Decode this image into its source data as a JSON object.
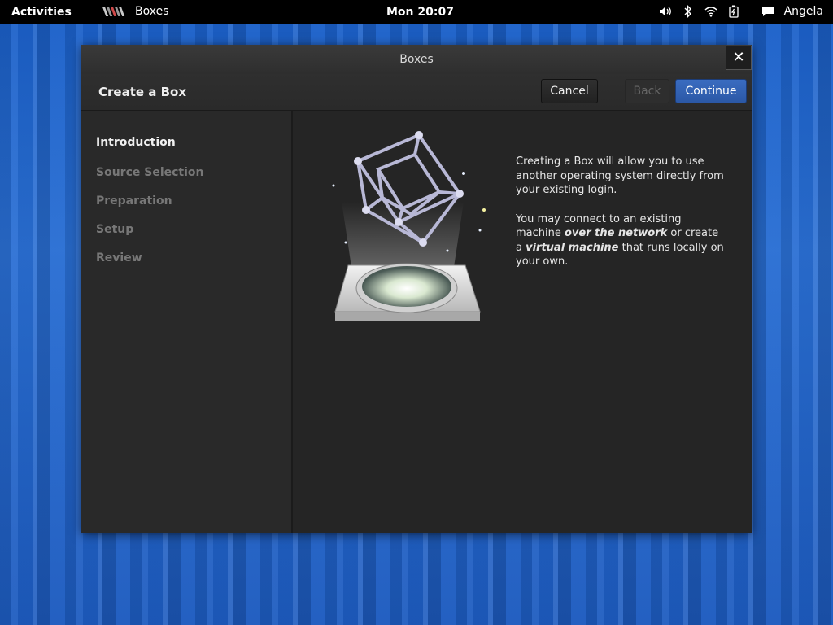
{
  "topbar": {
    "activities": "Activities",
    "app_name": "Boxes",
    "clock": "Mon 20:07",
    "user": "Angela",
    "tray_icons": [
      "volume-icon",
      "bluetooth-icon",
      "wifi-icon",
      "battery-icon",
      "chat-icon"
    ]
  },
  "window": {
    "title": "Boxes",
    "close_symbol": "✕",
    "header_title": "Create a Box",
    "buttons": {
      "cancel": "Cancel",
      "back": "Back",
      "continue": "Continue"
    }
  },
  "sidebar": {
    "steps": [
      {
        "label": "Introduction",
        "active": true
      },
      {
        "label": "Source Selection",
        "active": false
      },
      {
        "label": "Preparation",
        "active": false
      },
      {
        "label": "Setup",
        "active": false
      },
      {
        "label": "Review",
        "active": false
      }
    ]
  },
  "content": {
    "paragraph1": "Creating a Box will allow you to use another operating system directly from your existing login.",
    "paragraph2_prefix": "You may connect to an existing machine ",
    "paragraph2_em1": "over the network",
    "paragraph2_mid": " or create a ",
    "paragraph2_em2": "virtual machine",
    "paragraph2_suffix": " that runs locally on your own."
  },
  "colors": {
    "accent": "#2b58a6",
    "desktop": "#1f62c4",
    "window_bg": "#262626"
  }
}
